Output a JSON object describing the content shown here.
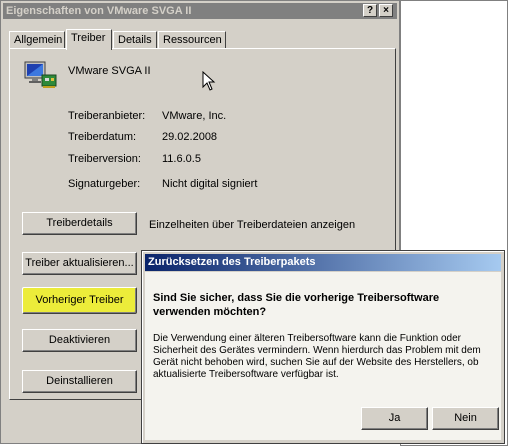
{
  "window": {
    "title": "Eigenschaften von VMware SVGA II",
    "help_btn": "?",
    "close_btn": "×"
  },
  "tabs": [
    "Allgemein",
    "Treiber",
    "Details",
    "Ressourcen"
  ],
  "driver": {
    "device_name": "VMware SVGA II",
    "rows": [
      {
        "label": "Treiberanbieter:",
        "value": "VMware, Inc."
      },
      {
        "label": "Treiberdatum:",
        "value": "29.02.2008"
      },
      {
        "label": "Treiberversion:",
        "value": "11.6.0.5"
      },
      {
        "label": "Signaturgeber:",
        "value": "Nicht digital signiert"
      }
    ]
  },
  "actions": {
    "details_btn": "Treiberdetails",
    "details_desc": "Einzelheiten über Treiberdateien anzeigen",
    "update_btn": "Treiber aktualisieren...",
    "rollback_btn": "Vorheriger Treiber",
    "disable_btn": "Deaktivieren",
    "uninstall_btn": "Deinstallieren"
  },
  "confirm": {
    "title": "Zurücksetzen des Treiberpakets",
    "question": "Sind Sie sicher, dass Sie die vorherige Treibersoftware verwenden möchten?",
    "body": "Die Verwendung einer älteren Treibersoftware kann die Funktion oder Sicherheit des Gerätes vermindern. Wenn hierdurch das Problem mit dem Gerät nicht behoben wird, suchen Sie auf der Website des Herstellers, ob aktualisierte Treibersoftware verfügbar ist.",
    "yes_btn": "Ja",
    "no_btn": "Nein"
  },
  "colors": {
    "highlight": "#ecec3a",
    "title_active_start": "#0a246a",
    "title_active_end": "#a6caf0",
    "title_inactive": "#808080"
  }
}
